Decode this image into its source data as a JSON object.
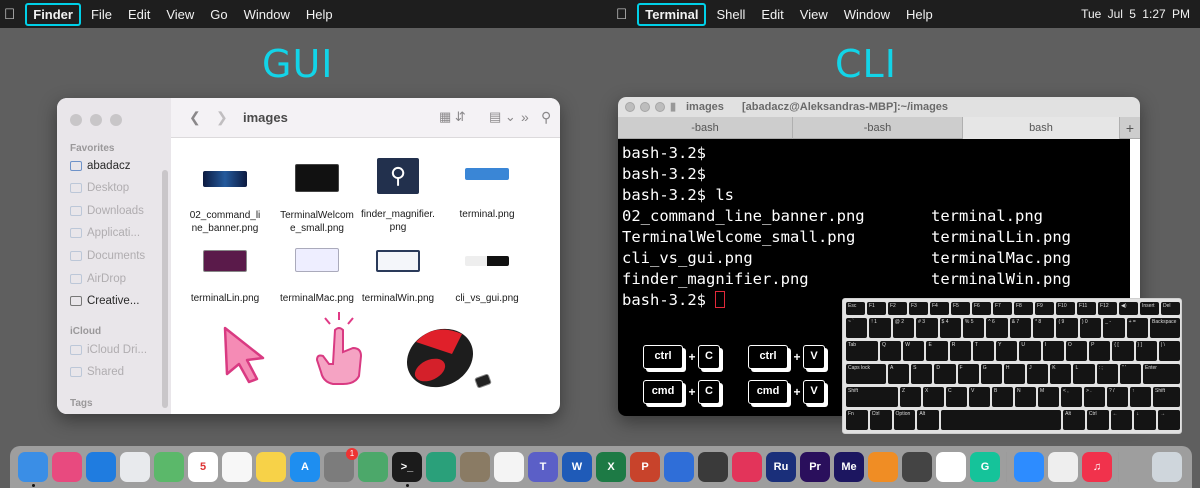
{
  "menubar": {
    "left_app": "Finder",
    "left_items": [
      "File",
      "Edit",
      "View",
      "Go",
      "Window",
      "Help"
    ],
    "right_app": "Terminal",
    "right_items": [
      "Shell",
      "Edit",
      "View",
      "Window",
      "Help"
    ],
    "clock": "Tue Jul 5  1:27 PM",
    "highlight_color": "#00d0e8"
  },
  "titles": {
    "gui": "GUI",
    "cli": "CLI"
  },
  "finder": {
    "folder": "images",
    "favorites_label": "Favorites",
    "favorites": [
      "abadacz",
      "Desktop",
      "Downloads",
      "Applicati...",
      "Documents",
      "AirDrop",
      "Creative..."
    ],
    "icloud_label": "iCloud",
    "icloud": [
      "iCloud Dri...",
      "Shared"
    ],
    "tags_label": "Tags",
    "files": [
      {
        "name": "02_command_line_banner.png",
        "icon": "banner-thumbnail"
      },
      {
        "name": "TerminalWelcome_small.png",
        "icon": "terminal-welcome-thumbnail"
      },
      {
        "name": "finder_magnifier.png",
        "icon": "magnifier-thumbnail"
      },
      {
        "name": "terminal.png",
        "icon": "terminal-thumbnail"
      },
      {
        "name": "terminalLin.png",
        "icon": "terminal-linux-thumbnail"
      },
      {
        "name": "terminalMac.png",
        "icon": "terminal-mac-thumbnail"
      },
      {
        "name": "terminalWin.png",
        "icon": "terminal-windows-thumbnail"
      },
      {
        "name": "cli_vs_gui.png",
        "icon": "cli-vs-gui-thumbnail"
      }
    ],
    "illustrations": [
      "pointer-arrow-icon",
      "tap-hand-icon",
      "computer-mouse-image"
    ]
  },
  "terminal": {
    "title_folder": "images",
    "title_path": "[abadacz@Aleksandras-MBP]:~/images",
    "tabs": [
      "-bash",
      "-bash",
      "bash"
    ],
    "lines": [
      "bash-3.2$",
      "bash-3.2$",
      "bash-3.2$ ls"
    ],
    "ls_rows": [
      [
        "02_command_line_banner.png",
        "terminal.png"
      ],
      [
        "TerminalWelcome_small.png",
        "terminalLin.png"
      ],
      [
        "cli_vs_gui.png",
        "terminalMac.png"
      ],
      [
        "finder_magnifier.png",
        "terminalWin.png"
      ]
    ],
    "prompt": "bash-3.2$",
    "shortcuts": [
      {
        "mod": "ctrl",
        "key": "C"
      },
      {
        "mod": "ctrl",
        "key": "V"
      },
      {
        "mod": "cmd",
        "key": "C"
      },
      {
        "mod": "cmd",
        "key": "V"
      }
    ],
    "plus": "+"
  },
  "keyboard": {
    "row1": [
      "Esc",
      "F1",
      "F2",
      "F3",
      "F4",
      "F5",
      "F6",
      "F7",
      "F8",
      "F9",
      "F10",
      "F11",
      "F12",
      "◀)",
      "Insert",
      "Del"
    ],
    "row2": [
      "~ `",
      "! 1",
      "@ 2",
      "# 3",
      "$ 4",
      "% 5",
      "^ 6",
      "& 7",
      "* 8",
      "( 9",
      ") 0",
      "_ -",
      "+ =",
      "Backspace"
    ],
    "row3": [
      "Tab",
      "Q",
      "W",
      "E",
      "R",
      "T",
      "Y",
      "U",
      "I",
      "O",
      "P",
      "{ [",
      "} ]",
      "| \\"
    ],
    "row4": [
      "Caps lock",
      "A",
      "S",
      "D",
      "F",
      "G",
      "H",
      "J",
      "K",
      "L",
      ": ;",
      "\" '",
      "Enter"
    ],
    "row5": [
      "Shift",
      "Z",
      "X",
      "C",
      "V",
      "B",
      "N",
      "M",
      "< ,",
      "> .",
      "? /",
      "↑",
      "Shift"
    ],
    "row6": [
      "Fn",
      "Ctrl",
      "Option",
      "Alt",
      "",
      "Alt",
      "Ctrl",
      "←",
      "↓",
      "→"
    ]
  },
  "dock": {
    "apps": [
      {
        "name": "finder-icon",
        "label": "",
        "color": "#3a8ee6"
      },
      {
        "name": "launchpad-icon",
        "label": "",
        "color": "#e84a7f"
      },
      {
        "name": "safari-icon",
        "label": "",
        "color": "#1f7ce0"
      },
      {
        "name": "chrome-icon",
        "label": "",
        "color": "#e8eaed"
      },
      {
        "name": "maps-icon",
        "label": "",
        "color": "#5bb86a"
      },
      {
        "name": "calendar-icon",
        "label": "5",
        "color": "#ffffff"
      },
      {
        "name": "reminders-icon",
        "label": "",
        "color": "#f7f7f7"
      },
      {
        "name": "notes-icon",
        "label": "",
        "color": "#f7d248"
      },
      {
        "name": "app-store-icon",
        "label": "A",
        "color": "#1e8ef0"
      },
      {
        "name": "system-preferences-icon",
        "label": "",
        "color": "#7c7c7c"
      },
      {
        "name": "atom-icon",
        "label": "",
        "color": "#4ca86a"
      },
      {
        "name": "terminal-icon",
        "label": ">_",
        "color": "#1b1b1b"
      },
      {
        "name": "sourcetree-icon",
        "label": "",
        "color": "#2aa07a"
      },
      {
        "name": "gimp-icon",
        "label": "",
        "color": "#8a7b64"
      },
      {
        "name": "inkscape-icon",
        "label": "",
        "color": "#f4f4f4"
      },
      {
        "name": "teams-icon",
        "label": "T",
        "color": "#5b5fc7"
      },
      {
        "name": "word-icon",
        "label": "W",
        "color": "#1f5bb8"
      },
      {
        "name": "excel-icon",
        "label": "X",
        "color": "#1d7a45"
      },
      {
        "name": "powerpoint-icon",
        "label": "P",
        "color": "#c8432b"
      },
      {
        "name": "keynote-icon",
        "label": "",
        "color": "#2f6ed8"
      },
      {
        "name": "quicktime-icon",
        "label": "",
        "color": "#3a3a3a"
      },
      {
        "name": "creative-cloud-icon",
        "label": "",
        "color": "#e3345a"
      },
      {
        "name": "rush-icon",
        "label": "Ru",
        "color": "#1a2f7a"
      },
      {
        "name": "premiere-icon",
        "label": "Pr",
        "color": "#2a0f5c"
      },
      {
        "name": "media-encoder-icon",
        "label": "Me",
        "color": "#1c1660"
      },
      {
        "name": "books-icon",
        "label": "",
        "color": "#f08d24"
      },
      {
        "name": "calculator-icon",
        "label": "",
        "color": "#444444"
      },
      {
        "name": "slack-icon",
        "label": "",
        "color": "#ffffff"
      },
      {
        "name": "grammarly-icon",
        "label": "G",
        "color": "#15c39a"
      },
      {
        "name": "zoom-icon",
        "label": "",
        "color": "#2d8cff"
      },
      {
        "name": "textedit-icon",
        "label": "",
        "color": "#eeeeee"
      },
      {
        "name": "music-icon",
        "label": "♫",
        "color": "#f1324c"
      },
      {
        "name": "trash-icon",
        "label": "",
        "color": "#cfd6dc"
      }
    ],
    "badge": "1"
  }
}
